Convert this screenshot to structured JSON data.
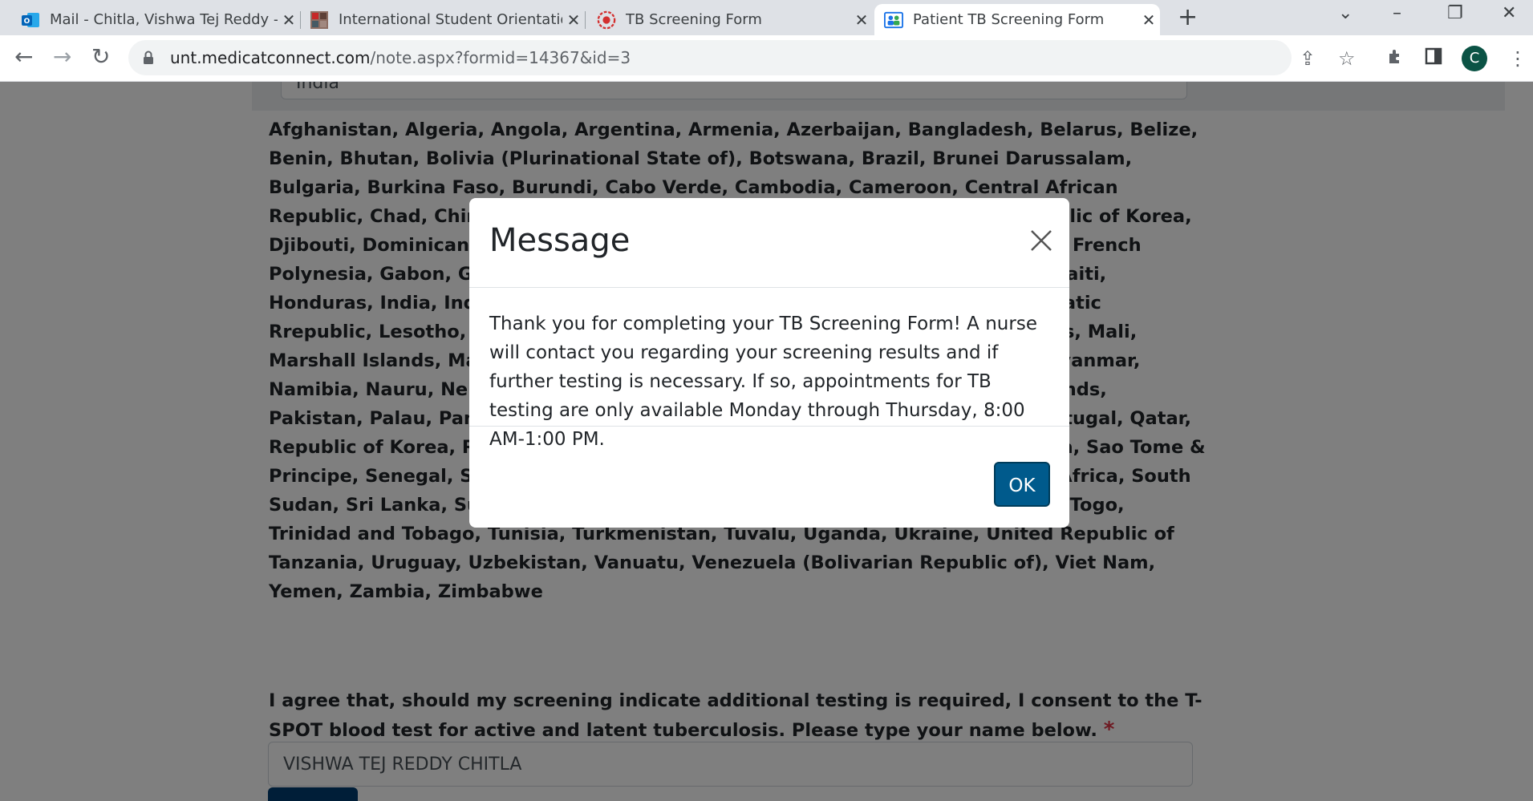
{
  "browser": {
    "tabs": [
      {
        "title": "Mail - Chitla, Vishwa Tej Reddy - O",
        "icon": "outlook-icon"
      },
      {
        "title": "International Student Orientation",
        "icon": "photo-icon"
      },
      {
        "title": "TB Screening Form",
        "icon": "medicat-icon"
      },
      {
        "title": "Patient TB Screening Form",
        "icon": "patient-icon"
      }
    ],
    "url_host": "unt.medicatconnect.com",
    "url_path": "/note.aspx?formid=14367&id=3",
    "profile_initial": "C"
  },
  "form": {
    "country_field_value": "India",
    "countries_text": "Afghanistan, Algeria, Angola, Argentina, Armenia, Azerbaijan, Bangladesh, Belarus, Belize, Benin, Bhutan, Bolivia (Plurinational State of), Botswana, Brazil, Brunei Darussalam, Bulgaria, Burkina Faso, Burundi, Cabo Verde, Cambodia, Cameroon, Central African Republic, Chad, China, Colombia, Comoros, Congo, Democratic People's Republic of Korea, Djibouti, Dominican Republic, Ecuador, El Salvador, Eritrea, Eswatini, Ethiopia, French Polynesia, Gabon, Gambia, Georgia, Ghana, Guinea, Guinea-Bissau, Guyana, Haiti, Honduras, India, Indonesia, Kazakhstan, Kenya, Kiribati, Lao People's Democratic Rrepublic, Lesotho, Liberia, Lithuania, Madagascar, Malawi, Malaysia, Maldives, Mali, Marshall Islands, Mauritania, Micronesia, Mongolia, Morocco, Mozambique, Myanmar, Namibia, Nauru, Nepal, Nicaragua, Niger, Nigeria, Niue, Northern Mariana Islands, Pakistan, Palau, Panama, Papua New Guinea, Paraguay, Peru, Philippines, Portugal, Qatar, Republic of Korea, Republic of Moldova, Romania, Russian Federation, Rwanda, Sao Tome & Principe, Senegal, Sierra Leone, Singapore, Soloman Islands, Somalia, South Africa, South Sudan, Sri Lanka, Sudan, Suriname, Taiwan, Tajikistan, Thailand, Timor-Leste, Togo, Trinidad and Tobago, Tunisia, Turkmenistan, Tuvalu, Uganda, Ukraine, United Republic of Tanzania, Uruguay, Uzbekistan, Vanuatu, Venezuela (Bolivarian Republic of), Viet Nam, Yemen, Zambia, Zimbabwe",
    "consent_text": "I agree that, should my screening indicate additional testing is required, I consent to the T-SPOT blood test for active and latent tuberculosis. Please type your name below.",
    "required_mark": "*",
    "name_value": "VISHWA TEJ REDDY CHITLA"
  },
  "modal": {
    "title": "Message",
    "body": "Thank you for completing your TB Screening Form! A nurse will contact you regarding your screening results and if further testing is necessary. If so, appointments for TB testing are only available Monday through Thursday, 8:00 AM-1:00 PM.",
    "ok_label": "OK"
  },
  "colors": {
    "primary_button": "#005a8c",
    "required": "#dc3545",
    "avatar": "#0b5345"
  }
}
